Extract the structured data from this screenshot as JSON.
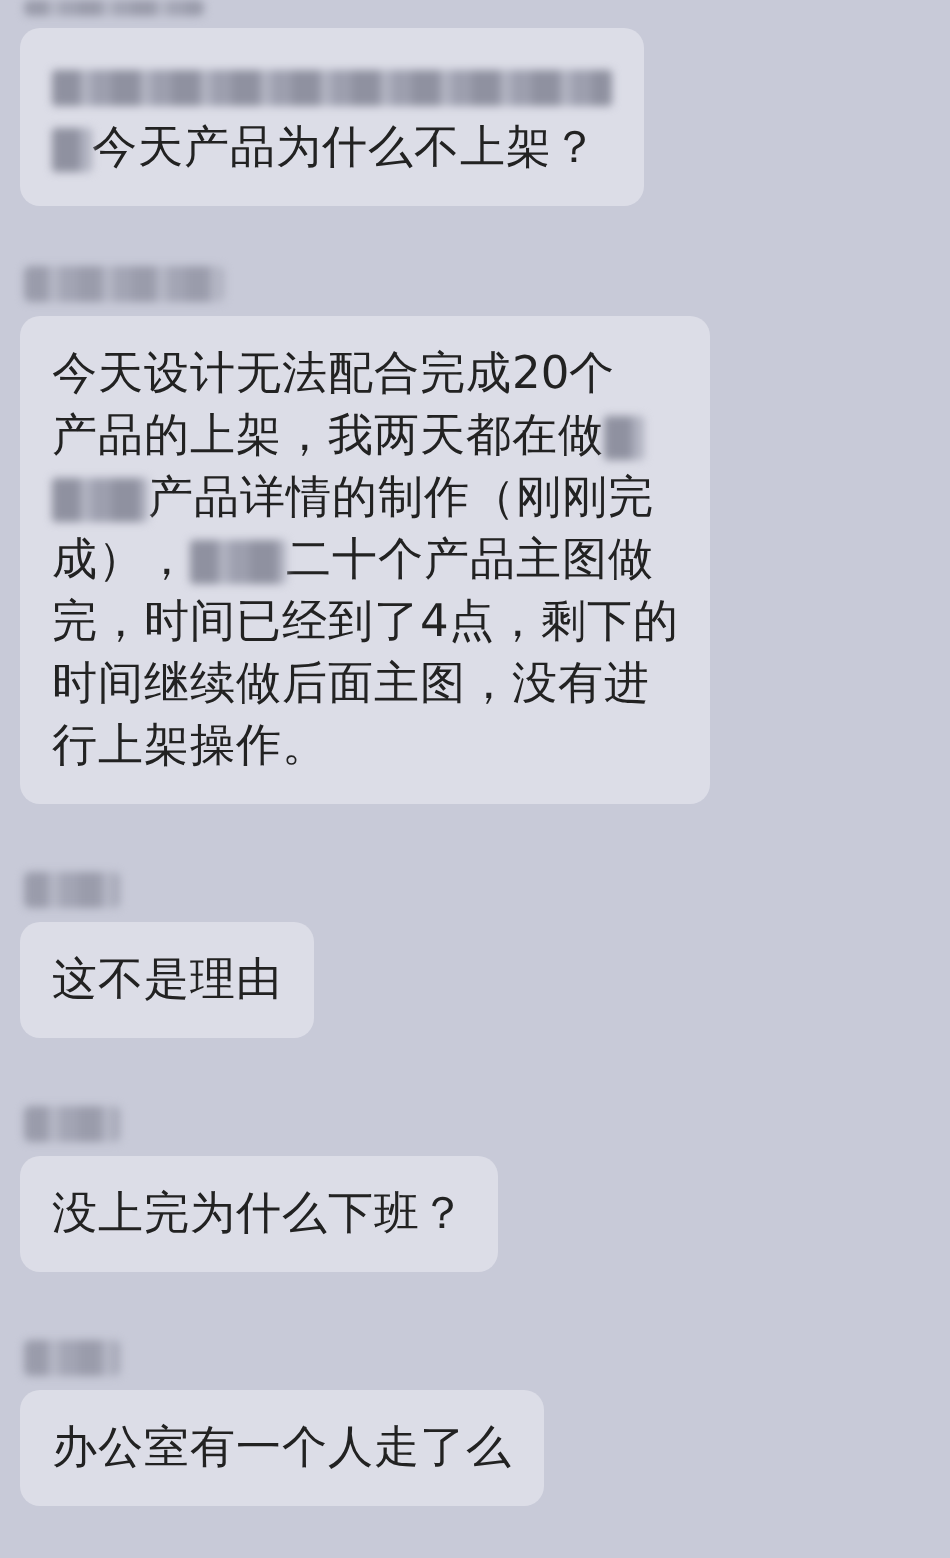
{
  "messages": [
    {
      "sender": {
        "kind": "stub"
      },
      "lines": [
        [
          {
            "kind": "stripe"
          }
        ],
        [
          {
            "kind": "dot"
          },
          {
            "kind": "text",
            "text": "今天产品为什么不上架？"
          }
        ]
      ]
    },
    {
      "sender": {
        "kind": "bar"
      },
      "lines": [
        [
          {
            "kind": "text",
            "text": "今天设计无法配合完成20个"
          }
        ],
        [
          {
            "kind": "text",
            "text": "产品的上架，我两天都在做"
          },
          {
            "kind": "dot"
          }
        ],
        [
          {
            "kind": "smudge"
          },
          {
            "kind": "text",
            "text": "产品详情的制作（刚刚完"
          }
        ],
        [
          {
            "kind": "text",
            "text": "成），"
          },
          {
            "kind": "smudge"
          },
          {
            "kind": "text",
            "text": "二十个产品主图做"
          }
        ],
        [
          {
            "kind": "text",
            "text": "完，时间已经到了4点，剩下的"
          }
        ],
        [
          {
            "kind": "text",
            "text": "时间继续做后面主图，没有进"
          }
        ],
        [
          {
            "kind": "text",
            "text": "行上架操作。"
          }
        ]
      ]
    },
    {
      "sender": {
        "kind": "smudge"
      },
      "lines": [
        [
          {
            "kind": "text",
            "text": "这不是理由"
          }
        ]
      ]
    },
    {
      "sender": {
        "kind": "smudge"
      },
      "lines": [
        [
          {
            "kind": "text",
            "text": "没上完为什么下班？"
          }
        ]
      ]
    },
    {
      "sender": {
        "kind": "smudge"
      },
      "lines": [
        [
          {
            "kind": "text",
            "text": "办公室有一个人走了么"
          }
        ]
      ]
    }
  ]
}
